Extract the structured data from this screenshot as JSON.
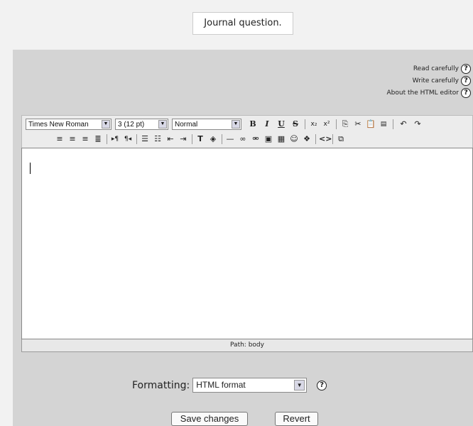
{
  "question": {
    "text": "Journal question."
  },
  "help_links": [
    {
      "label": "Read carefully"
    },
    {
      "label": "Write carefully"
    },
    {
      "label": "About the HTML editor"
    }
  ],
  "help_glyph": "?",
  "toolbar": {
    "font_family": "Times New Roman",
    "font_size": "3 (12 pt)",
    "block_format": "Normal",
    "row1_icons": [
      "bold-icon",
      "italic-icon",
      "underline-icon",
      "strikethrough-icon",
      "subscript-icon",
      "superscript-icon",
      "copy-icon",
      "cut-icon",
      "paste-icon",
      "paste-word-icon",
      "undo-icon",
      "redo-icon"
    ],
    "row2_icons": [
      "align-left-icon",
      "align-center-icon",
      "align-right-icon",
      "justify-icon",
      "ltr-icon",
      "rtl-icon",
      "ordered-list-icon",
      "unordered-list-icon",
      "outdent-icon",
      "indent-icon",
      "text-color-icon",
      "bg-color-icon",
      "horizontal-rule-icon",
      "link-icon",
      "unlink-icon",
      "image-icon",
      "table-icon",
      "smiley-icon",
      "special-char-icon",
      "html-source-icon",
      "fullscreen-icon"
    ]
  },
  "path_bar": {
    "text": "Path:  body"
  },
  "formatting": {
    "label": "Formatting:",
    "value": "HTML format"
  },
  "buttons": {
    "save": "Save changes",
    "revert": "Revert"
  }
}
